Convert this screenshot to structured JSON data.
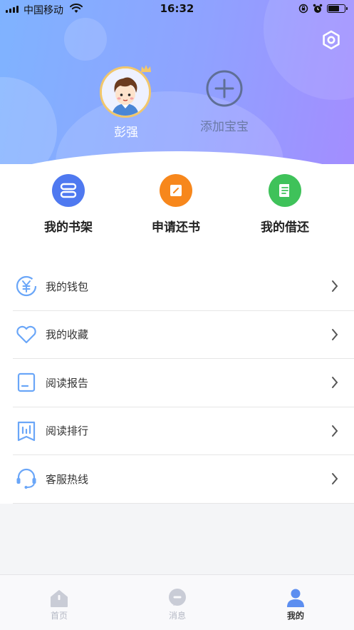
{
  "status_bar": {
    "carrier": "中国移动",
    "time": "16:32"
  },
  "profile": {
    "baby_name": "彭强",
    "add_baby_label": "添加宝宝"
  },
  "quick_actions": [
    {
      "label": "我的书架",
      "icon": "bookshelf-icon",
      "color": "#4f79f0"
    },
    {
      "label": "申请还书",
      "icon": "return-book-icon",
      "color": "#f7871c"
    },
    {
      "label": "我的借还",
      "icon": "borrow-return-icon",
      "color": "#3fc25a"
    }
  ],
  "menu": [
    {
      "label": "我的钱包",
      "icon": "wallet-icon"
    },
    {
      "label": "我的收藏",
      "icon": "heart-icon"
    },
    {
      "label": "阅读报告",
      "icon": "report-icon"
    },
    {
      "label": "阅读排行",
      "icon": "ranking-icon"
    },
    {
      "label": "客服热线",
      "icon": "headset-icon"
    }
  ],
  "tabbar": [
    {
      "label": "首页",
      "icon": "home-icon",
      "active": false
    },
    {
      "label": "消息",
      "icon": "message-icon",
      "active": false
    },
    {
      "label": "我的",
      "icon": "user-icon",
      "active": true
    }
  ],
  "colors": {
    "header_gradient_start": "#7fb3ff",
    "header_gradient_end": "#a38dff",
    "menu_icon": "#6aa6f8",
    "tab_active": "#5c8ef0",
    "tab_inactive": "#c9ccd6"
  }
}
